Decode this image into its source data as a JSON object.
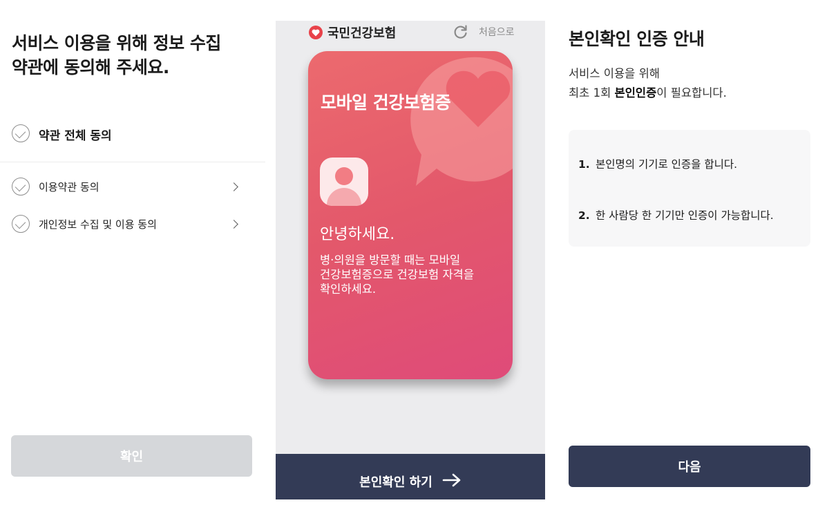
{
  "terms": {
    "title": "서비스 이용을 위해 정보 수집\n약관에 동의해 주세요.",
    "agree_all": "약관 전체 동의",
    "items": [
      {
        "label": "이용약관 동의"
      },
      {
        "label": "개인정보 수집 및 이용 동의"
      }
    ],
    "confirm_label": "확인"
  },
  "card_screen": {
    "brand": "국민건강보험",
    "restart_label": "처음으로",
    "card_title": "모바일 건강보험증",
    "greeting": "안녕하세요.",
    "description": "병·의원을 방문할 때는 모바일\n건강보험증으로 건강보험 자격을\n확인하세요.",
    "verify_label": "본인확인 하기",
    "colors": {
      "brand": "#e8424a",
      "card_top": "#ec6a6e",
      "card_bottom": "#df4b79",
      "bar": "#333b56"
    }
  },
  "auth_guide": {
    "title": "본인확인 인증 안내",
    "line1": "서비스 이용을 위해",
    "line2_pre": "최초 1회 ",
    "line2_bold": "본인인증",
    "line2_post": "이 필요합니다.",
    "steps": [
      {
        "num": "1.",
        "text": "본인명의 기기로 인증을 합니다."
      },
      {
        "num": "2.",
        "text": "한 사람당 한 기기만 인증이 가능합니다."
      }
    ],
    "next_label": "다음"
  },
  "icons": [
    "check-circle-icon",
    "chevron-right-icon",
    "heart-logo-icon",
    "reload-icon",
    "arrow-right-icon",
    "avatar-icon"
  ]
}
